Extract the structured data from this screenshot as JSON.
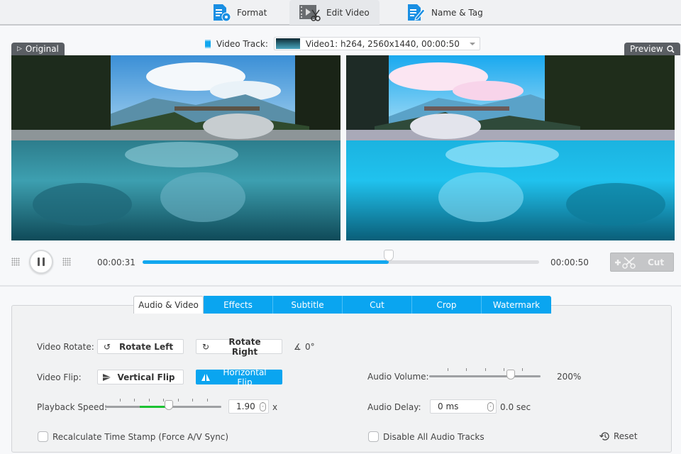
{
  "top_tabs": [
    {
      "label": "Format",
      "icon": "format-settings-icon",
      "active": false
    },
    {
      "label": "Edit Video",
      "icon": "edit-video-icon",
      "active": true
    },
    {
      "label": "Name & Tag",
      "icon": "name-tag-icon",
      "active": false
    }
  ],
  "preview": {
    "original_label": "Original",
    "preview_label": "Preview",
    "video_track_label": "Video Track:",
    "video_track_value": "Video1: h264, 2560x1440, 00:00:50"
  },
  "playback": {
    "current_time": "00:00:31",
    "total_time": "00:00:50",
    "progress_fraction": 0.62,
    "cut_label": "Cut",
    "state": "playing"
  },
  "edit_tabs": [
    {
      "label": "Audio & Video",
      "active": true
    },
    {
      "label": "Effects",
      "active": false
    },
    {
      "label": "Subtitle",
      "active": false
    },
    {
      "label": "Cut",
      "active": false
    },
    {
      "label": "Crop",
      "active": false
    },
    {
      "label": "Watermark",
      "active": false
    }
  ],
  "audio_video": {
    "rotate_label": "Video Rotate:",
    "rotate_left": "Rotate Left",
    "rotate_right": "Rotate Right",
    "rotate_angle": "0°",
    "flip_label": "Video Flip:",
    "vertical_flip": "Vertical Flip",
    "horizontal_flip": "Horizontal Flip",
    "horizontal_flip_active": true,
    "speed_label": "Playback Speed:",
    "speed_value": "1.90",
    "speed_unit": "x",
    "speed_slider_fraction": 0.55,
    "recalc_label": "Recalculate Time Stamp (Force A/V Sync)",
    "recalc_checked": false,
    "volume_label": "Audio Volume:",
    "volume_value": "200%",
    "volume_slider_fraction": 0.73,
    "delay_label": "Audio Delay:",
    "delay_value": "0 ms",
    "delay_sec": "0.0 sec",
    "disable_audio_label": "Disable All Audio Tracks",
    "disable_audio_checked": false,
    "reset_label": "Reset"
  }
}
